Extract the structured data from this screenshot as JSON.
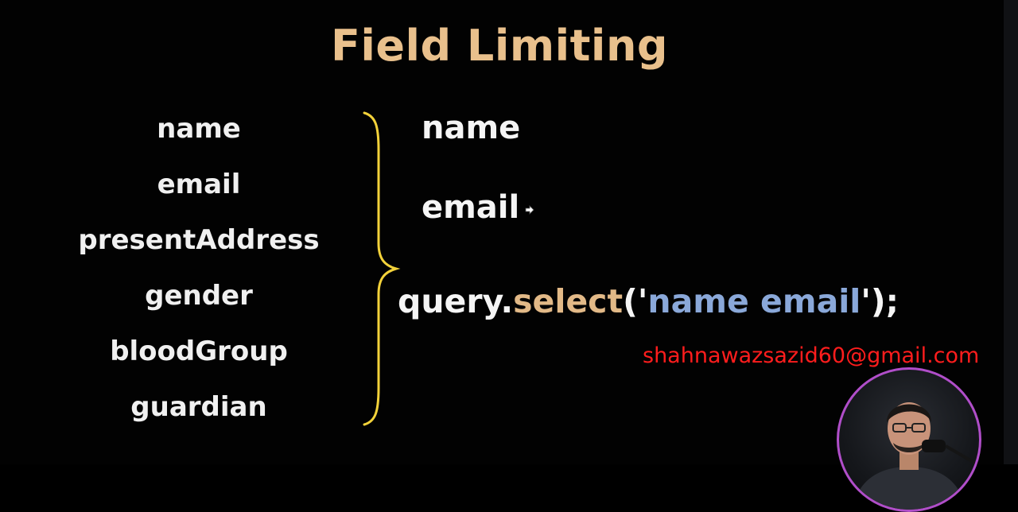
{
  "slide": {
    "title": "Field Limiting",
    "fields": [
      "name",
      "email",
      "presentAddress",
      "gender",
      "bloodGroup",
      "guardian"
    ],
    "selected": [
      "name",
      "email"
    ],
    "code": {
      "object": "query.",
      "method": "select",
      "open": "('",
      "argument": "name email",
      "close": "');"
    }
  },
  "overlay": {
    "email": "shahnawazsazid60@gmail.com"
  },
  "colors": {
    "title": "#e9c08c",
    "method": "#e2b987",
    "string": "#8aa8d9",
    "brace": "#f3d23a",
    "overlay_text": "#ff1d1d",
    "webcam_ring": "#b04ec9"
  },
  "icons": {
    "pointer": "cursor-icon"
  }
}
